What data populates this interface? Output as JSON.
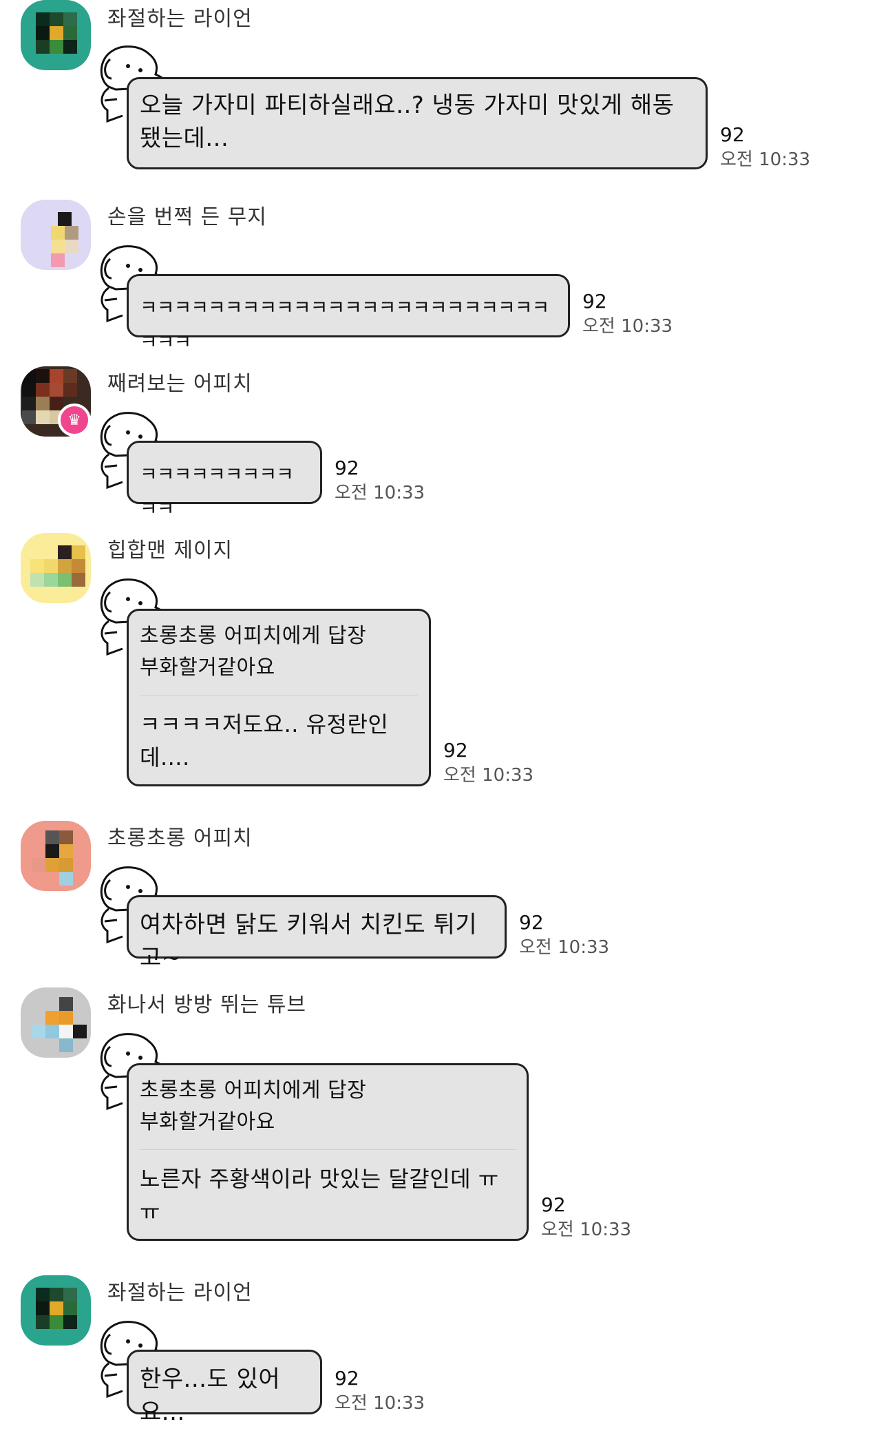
{
  "messages": [
    {
      "sender": "좌절하는 라이언",
      "text": "오늘 가자미 파티하실래요..? 냉동 가자미 맛있게 해동됐는데...",
      "read_count": "92",
      "time": "오전 10:33",
      "avatar": "frustrated-lion"
    },
    {
      "sender": "손을 번쩍 든 무지",
      "text": "ㅋㅋㅋㅋㅋㅋㅋㅋㅋㅋㅋㅋㅋㅋㅋㅋㅋㅋㅋㅋㅋㅋㅋㅋㅋㅋㅋ",
      "read_count": "92",
      "time": "오전 10:33",
      "avatar": "hand-raised-muzi"
    },
    {
      "sender": "째려보는 어피치",
      "text": "ㅋㅋㅋㅋㅋㅋㅋㅋㅋㅋㅋ",
      "read_count": "92",
      "time": "오전 10:33",
      "avatar": "glaring-apeach",
      "host_badge": "♛"
    },
    {
      "sender": "힙합맨 제이지",
      "reply_to": "초롱초롱 어피치에게 답장",
      "quoted": "부화할거같아요",
      "text": "ㅋㅋㅋㅋ저도요.. 유정란인데....",
      "read_count": "92",
      "time": "오전 10:33",
      "avatar": "hiphop-jayg"
    },
    {
      "sender": "초롱초롱 어피치",
      "text": "여차하면 닭도 키워서 치킨도 튀기고~",
      "read_count": "92",
      "time": "오전 10:33",
      "avatar": "sparkly-apeach"
    },
    {
      "sender": "화나서 방방 뛰는 튜브",
      "reply_to": "초롱초롱 어피치에게 답장",
      "quoted": "부화할거같아요",
      "text": "노른자 주황색이라 맛있는 달걀인데 ㅠㅠ",
      "read_count": "92",
      "time": "오전 10:33",
      "avatar": "angry-tube"
    },
    {
      "sender": "좌절하는 라이언",
      "text": "한우...도 있어요...",
      "read_count": "92",
      "time": "오전 10:33",
      "avatar": "frustrated-lion"
    }
  ],
  "colors": {
    "bubble_bg": "#e4e4e4",
    "bubble_border": "#222222",
    "host_badge": "#f0458f"
  }
}
